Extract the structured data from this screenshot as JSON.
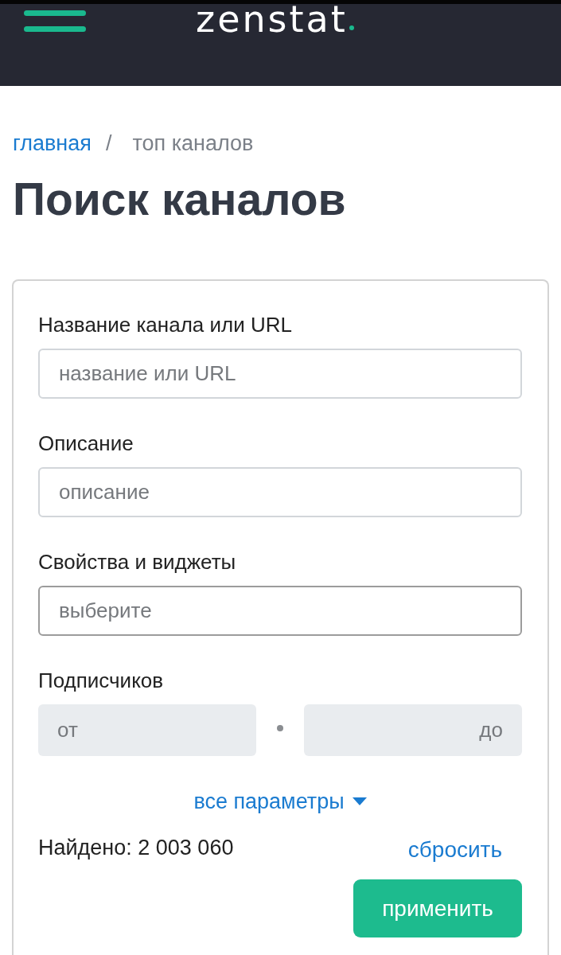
{
  "header": {
    "logo": "zenstat"
  },
  "breadcrumb": {
    "separator": "/",
    "items": [
      {
        "label": "главная",
        "current": false
      },
      {
        "label": "топ каналов",
        "current": true
      }
    ]
  },
  "title": "Поиск каналов",
  "filters": {
    "fields": [
      {
        "kind": "text",
        "label": "Название канала или URL",
        "placeholder": "название или URL"
      },
      {
        "kind": "text",
        "label": "Описание",
        "placeholder": "описание"
      },
      {
        "kind": "select",
        "label": "Свойства и виджеты",
        "placeholder": "выберите"
      },
      {
        "kind": "range",
        "label": "Подписчиков",
        "from": {
          "placeholder": "от"
        },
        "to": {
          "placeholder": "до"
        }
      }
    ],
    "more_link": "все параметры",
    "found": "Найдено: 2 003 060",
    "reset": "сбросить",
    "apply": "применить"
  }
}
